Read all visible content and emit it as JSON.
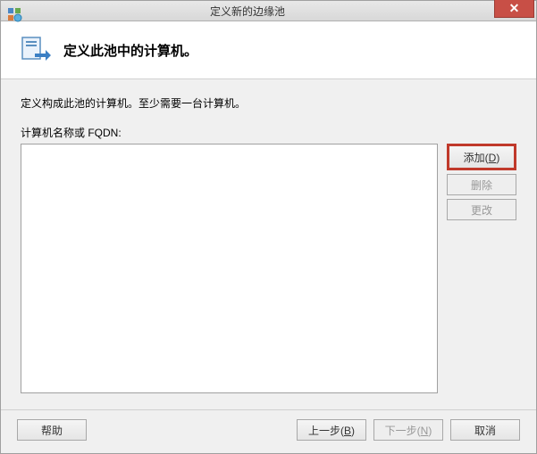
{
  "titlebar": {
    "title": "定义新的边缘池"
  },
  "header": {
    "title": "定义此池中的计算机。"
  },
  "content": {
    "instruction": "定义构成此池的计算机。至少需要一台计算机。",
    "label": "计算机名称或 FQDN:"
  },
  "buttons": {
    "add": "添加(D)",
    "remove": "删除",
    "modify": "更改",
    "help": "帮助",
    "back": "上一步(B)",
    "next": "下一步(N)",
    "cancel": "取消"
  }
}
